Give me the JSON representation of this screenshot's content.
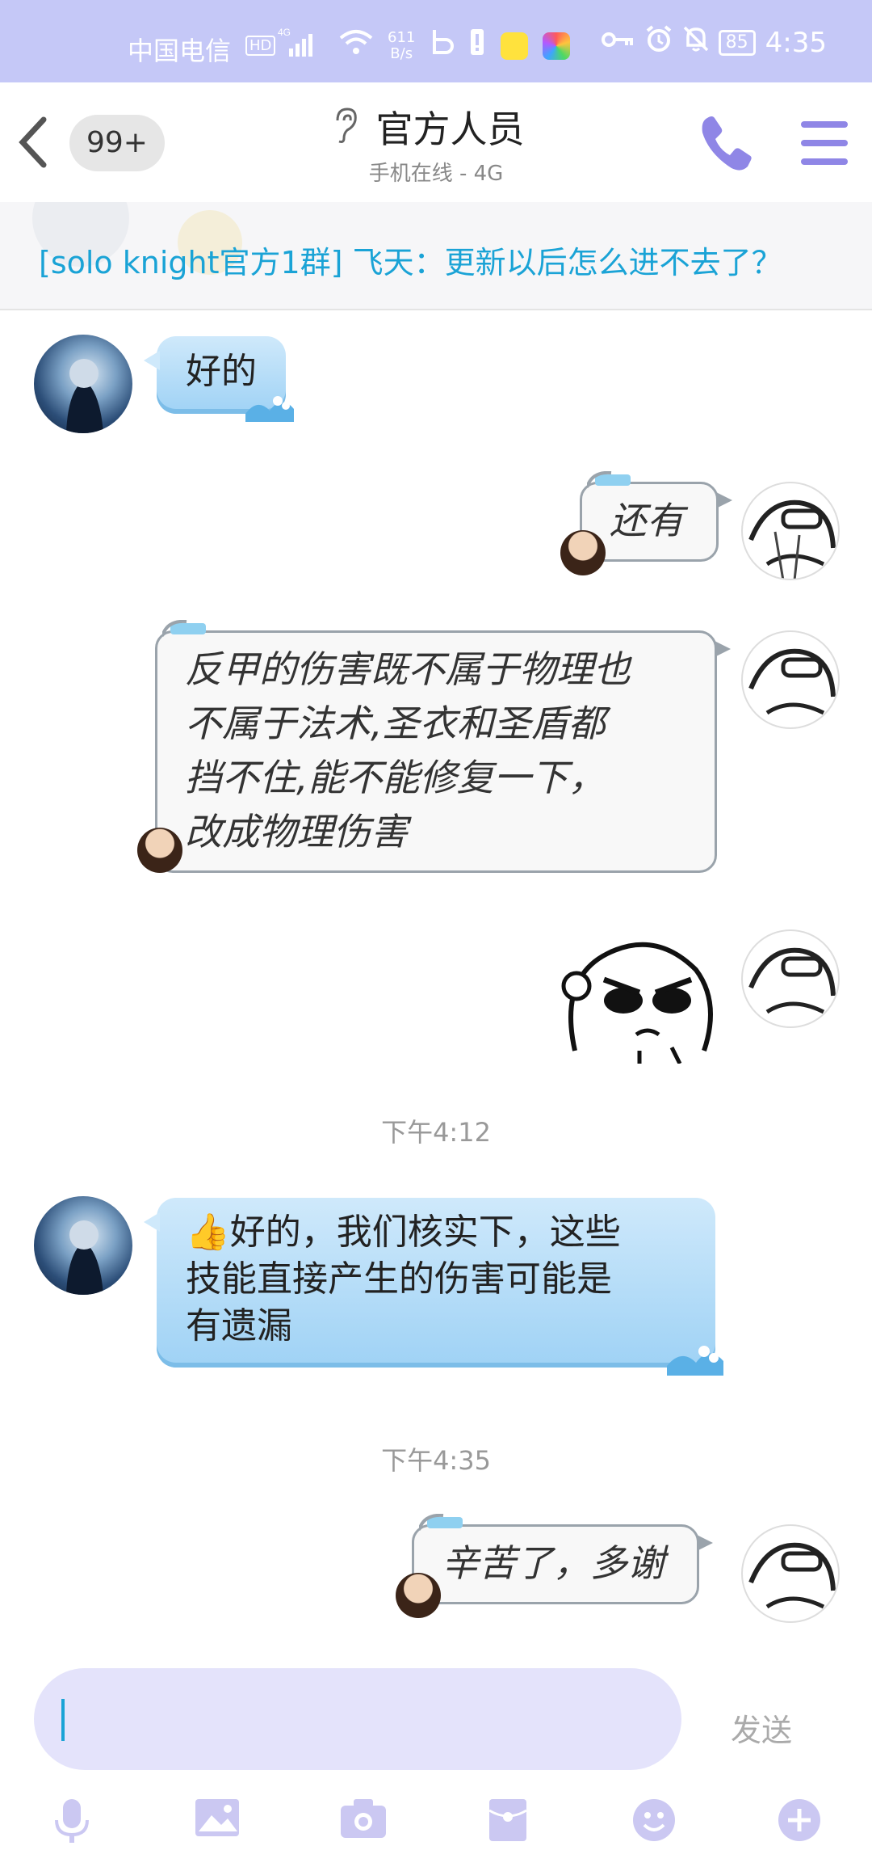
{
  "status_bar": {
    "carrier": "中国电信",
    "hd": "HD",
    "network": "4G",
    "speed_value": "611",
    "speed_unit": "B/s",
    "battery": "85",
    "time": "4:35"
  },
  "header": {
    "unread_badge": "99+",
    "title": "官方人员",
    "subtitle": "手机在线 - 4G"
  },
  "notice": {
    "text": "[solo knight官方1群] 飞天：更新以后怎么进不去了？"
  },
  "messages": [
    {
      "side": "in",
      "text": "好的"
    },
    {
      "side": "out",
      "text": "还有"
    },
    {
      "side": "out",
      "lines": [
        "反甲的伤害既不属于物理也",
        "不属于法术,圣衣和圣盾都",
        "挡不住,能不能修复一下，",
        "改成物理伤害"
      ]
    },
    {
      "side": "out",
      "sticker": "angry-cartoon-face-sticker"
    },
    {
      "timestamp": "下午4:12"
    },
    {
      "side": "in",
      "emoji": "👍",
      "lines": [
        "好的，我们核实下，这些",
        "技能直接产生的伤害可能是",
        "有遗漏"
      ]
    },
    {
      "timestamp": "下午4:35"
    },
    {
      "side": "out",
      "text": "辛苦了，多谢"
    }
  ],
  "input": {
    "value": "",
    "send_label": "发送"
  },
  "toolbar": [
    "microphone-icon",
    "image-icon",
    "camera-icon",
    "red-packet-icon",
    "emoji-icon",
    "plus-icon"
  ],
  "colors": {
    "status_bar": "#c5c8f7",
    "accent_purple": "#8f86e6",
    "notice_link": "#1aa3d6",
    "incoming_bubble": "#aedbf7",
    "input_bg": "#e4e3fb"
  }
}
